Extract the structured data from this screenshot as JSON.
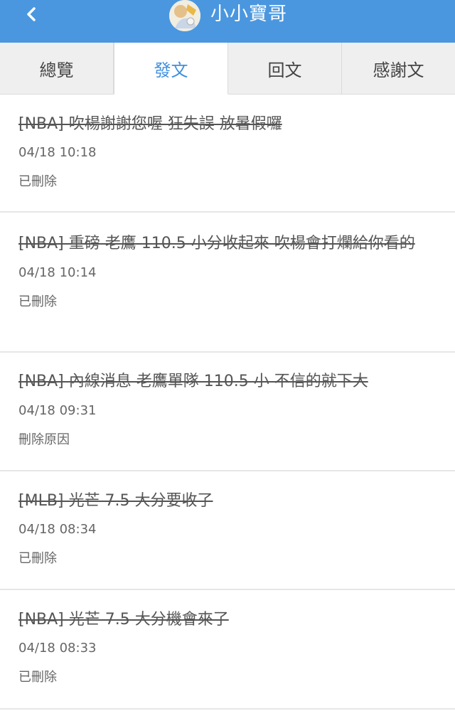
{
  "header": {
    "back_icon": "chevron-left-icon",
    "user_name": "小小寶哥",
    "colors": {
      "bar": "#4a97df",
      "text": "#ffffff"
    }
  },
  "tabs": [
    {
      "label": "總覽",
      "active": false
    },
    {
      "label": "發文",
      "active": true
    },
    {
      "label": "回文",
      "active": false
    },
    {
      "label": "感謝文",
      "active": false
    }
  ],
  "active_tab_color": "#3d8fe0",
  "posts": [
    {
      "title": "[NBA] 吹楊謝謝您喔 狂失誤 放暑假囉",
      "date": "04/18 10:18",
      "status": "已刪除"
    },
    {
      "title": "[NBA] 重磅 老鷹 110.5 小分收起來 吹楊會打爛給你看的",
      "date": "04/18 10:14",
      "status": "已刪除"
    },
    {
      "title": "[NBA] 內線消息 老鷹單隊 110.5 小 不信的就下大",
      "date": "04/18 09:31",
      "status": "刪除原因"
    },
    {
      "title": "[MLB] 光芒 7.5 大分要收了",
      "date": "04/18 08:34",
      "status": "已刪除"
    },
    {
      "title": "[NBA] 光芒 7.5 大分機會來了",
      "date": "04/18 08:33",
      "status": "已刪除"
    }
  ]
}
